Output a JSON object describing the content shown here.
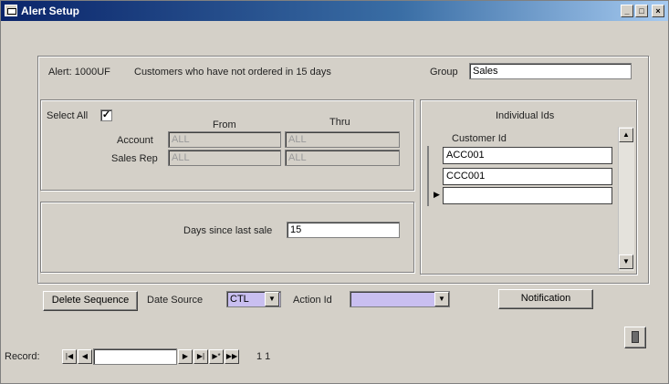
{
  "window": {
    "title": "Alert Setup"
  },
  "alert": {
    "label": "Alert: 1000UF",
    "description": "Customers who have not ordered in 15 days"
  },
  "group": {
    "label": "Group",
    "value": "Sales"
  },
  "selection": {
    "select_all_label": "Select All",
    "select_all_checked": "✓",
    "from_header": "From",
    "thru_header": "Thru",
    "rows": [
      {
        "label": "Account",
        "from": "ALL",
        "thru": "ALL"
      },
      {
        "label": "Sales Rep",
        "from": "ALL",
        "thru": "ALL"
      }
    ]
  },
  "days": {
    "label": "Days since last sale",
    "value": "15"
  },
  "individual": {
    "header": "Individual Ids",
    "column": "Customer Id",
    "rows": [
      "ACC001",
      "CCC001",
      ""
    ]
  },
  "bottom": {
    "delete_sequence": "Delete Sequence",
    "date_source_label": "Date Source",
    "date_source_value": "CTL",
    "action_id_label": "Action Id",
    "action_id_value": "",
    "notification": "Notification"
  },
  "nav": {
    "record_label": "Record:",
    "record_value": "",
    "counter": "1 1"
  }
}
